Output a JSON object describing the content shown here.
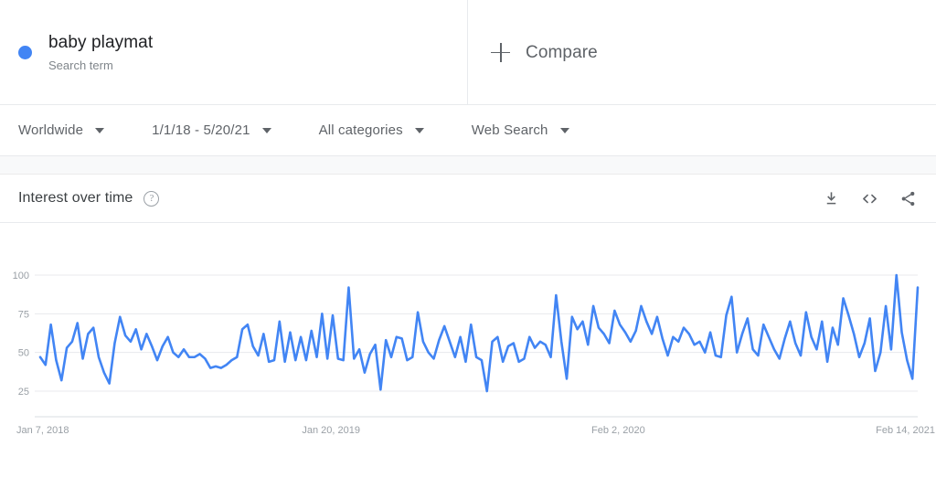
{
  "terms": [
    {
      "label": "baby playmat",
      "sublabel": "Search term",
      "color": "#4285f4"
    }
  ],
  "compare": {
    "label": "Compare",
    "icon": "plus-icon"
  },
  "filters": [
    {
      "label": "Worldwide",
      "name": "location-filter"
    },
    {
      "label": "1/1/18 - 5/20/21",
      "name": "date-range-filter"
    },
    {
      "label": "All categories",
      "name": "category-filter"
    },
    {
      "label": "Web Search",
      "name": "search-type-filter"
    }
  ],
  "card": {
    "title": "Interest over time",
    "help_icon": "help-circle-icon",
    "actions": [
      {
        "name": "download-icon",
        "label": "download"
      },
      {
        "name": "embed-code-icon",
        "label": "embed"
      },
      {
        "name": "share-icon",
        "label": "share"
      }
    ]
  },
  "chart_data": {
    "type": "line",
    "title": "Interest over time",
    "xlabel": "",
    "ylabel": "",
    "ylim": [
      0,
      108
    ],
    "yticks": [
      25,
      50,
      75,
      100
    ],
    "ytick_labels": [
      "25",
      "50",
      "75",
      "100"
    ],
    "grid": true,
    "legend_position": "top",
    "xticks": [
      0,
      54,
      108,
      162
    ],
    "xtick_labels": [
      "Jan 7, 2018",
      "Jan 20, 2019",
      "Feb 2, 2020",
      "Feb 14, 2021"
    ],
    "line_color": "#4285f4",
    "series": [
      {
        "name": "baby playmat",
        "values": [
          47,
          42,
          68,
          45,
          32,
          53,
          57,
          69,
          46,
          62,
          66,
          47,
          37,
          30,
          56,
          73,
          61,
          57,
          65,
          52,
          62,
          54,
          45,
          54,
          60,
          50,
          47,
          52,
          47,
          47,
          49,
          46,
          40,
          41,
          40,
          42,
          45,
          47,
          65,
          68,
          54,
          48,
          62,
          44,
          45,
          70,
          44,
          63,
          45,
          60,
          45,
          64,
          47,
          75,
          46,
          74,
          46,
          45,
          92,
          46,
          52,
          37,
          49,
          55,
          26,
          58,
          47,
          60,
          59,
          45,
          47,
          76,
          57,
          50,
          46,
          58,
          67,
          57,
          47,
          60,
          44,
          68,
          47,
          45,
          25,
          57,
          60,
          44,
          54,
          56,
          44,
          46,
          60,
          53,
          57,
          55,
          47,
          87,
          57,
          33,
          73,
          65,
          70,
          55,
          80,
          66,
          62,
          56,
          77,
          68,
          63,
          57,
          64,
          80,
          70,
          62,
          73,
          59,
          48,
          60,
          57,
          66,
          62,
          55,
          57,
          50,
          63,
          48,
          47,
          74,
          86,
          50,
          62,
          72,
          52,
          48,
          68,
          60,
          52,
          46,
          59,
          70,
          56,
          48,
          76,
          60,
          52,
          70,
          44,
          66,
          55,
          85,
          74,
          62,
          47,
          56,
          72,
          38,
          50,
          80,
          52,
          100,
          63,
          45,
          33,
          92
        ]
      }
    ]
  }
}
